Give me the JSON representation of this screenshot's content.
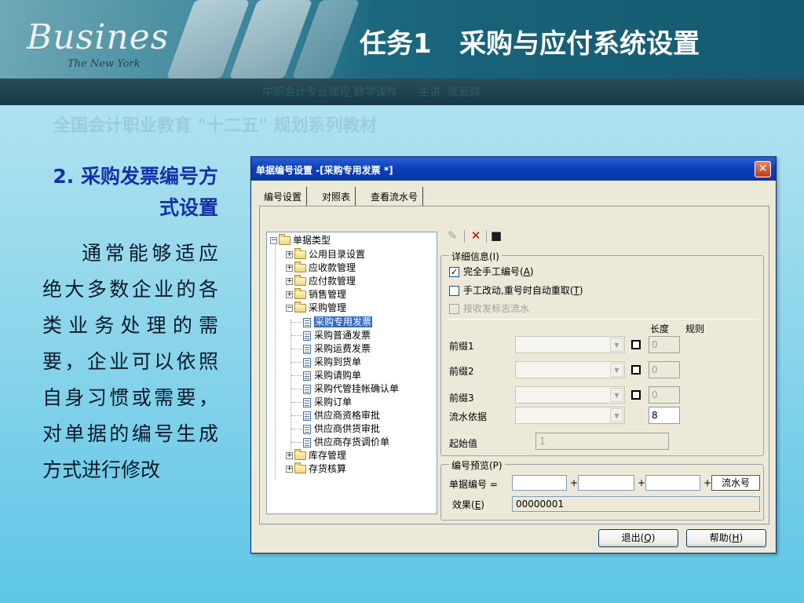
{
  "banner": {
    "logo_word": "Busines",
    "logo_sub": "The New York",
    "slide_title": "任务1   采购与应付系统设置",
    "subtitle_text": "中职会计专业课程 教学课件      主讲  张若辉",
    "ghost_text": "全国会计职业教育 \"十二五\" 规划系列教材"
  },
  "left_panel": {
    "heading": "2. 采购发票编号方式设置",
    "body": "通常能够适应绝大多数企业的各类业务处理的需要，企业可以依照自身习惯或需要，对单据的编号生成方式进行修改"
  },
  "dialog": {
    "title": "单据编号设置 -[采购专用发票 *]",
    "close_glyph": "✕",
    "tabs": [
      "编号设置",
      "对照表",
      "查看流水号"
    ],
    "tree": {
      "root": "单据类型",
      "items": [
        {
          "label": "公用目录设置",
          "expander": "+"
        },
        {
          "label": "应收款管理",
          "expander": "+"
        },
        {
          "label": "应付款管理",
          "expander": "+"
        },
        {
          "label": "销售管理",
          "expander": "+"
        },
        {
          "label": "采购管理",
          "expander": "−"
        },
        {
          "label": "采购专用发票",
          "child": true,
          "selected": true
        },
        {
          "label": "采购普通发票",
          "child": true
        },
        {
          "label": "采购运费发票",
          "child": true
        },
        {
          "label": "采购到货单",
          "child": true
        },
        {
          "label": "采购请购单",
          "child": true
        },
        {
          "label": "采购代管挂帐确认单",
          "child": true
        },
        {
          "label": "采购订单",
          "child": true
        },
        {
          "label": "供应商资格审批",
          "child": true
        },
        {
          "label": "供应商供货审批",
          "child": true
        },
        {
          "label": "供应商存货调价单",
          "child": true
        },
        {
          "label": "库存管理",
          "expander": "+"
        },
        {
          "label": "存货核算",
          "expander": "+"
        }
      ],
      "root_expander": "−"
    },
    "toolbar": {
      "edit_icon": "✎",
      "delete_icon": "✕",
      "save_icon": "■"
    },
    "detail": {
      "legend": "详细信息(I)",
      "legend_key": "I",
      "opt_manual": "完全手工编号(",
      "opt_manual_key": "A",
      "opt_manual_checked": true,
      "opt_retry": "手工改动,重号时自动重取(",
      "opt_retry_key": "T",
      "opt_retry_checked": false,
      "opt_flow": "按收发标志流水",
      "check_mark": "✓",
      "col_length": "长度",
      "col_rule": "规则",
      "prefix1": "前缀1",
      "prefix1_len": "0",
      "prefix2": "前缀2",
      "prefix2_len": "0",
      "prefix3": "前缀3",
      "prefix3_len": "0",
      "serial_basis": "流水依据",
      "serial_len": "8",
      "start_value_label": "起始值",
      "start_value": "1"
    },
    "preview": {
      "legend": "编号预览(P)",
      "doc_no_label": "单据编号  =",
      "serial_btn": "流水号",
      "effect_label": "效果(",
      "effect_key": "E",
      "effect_value": "00000001",
      "plus": "+"
    },
    "buttons": {
      "exit": "退出(",
      "exit_key": "Q",
      "help": "帮助(",
      "help_key": "H",
      "close_paren": ")"
    }
  },
  "colors": {
    "heading_blue": "#1432a8",
    "body_text": "#0d1a2a",
    "title_bar": "#0a3fb8",
    "selected": "#316ac5"
  }
}
